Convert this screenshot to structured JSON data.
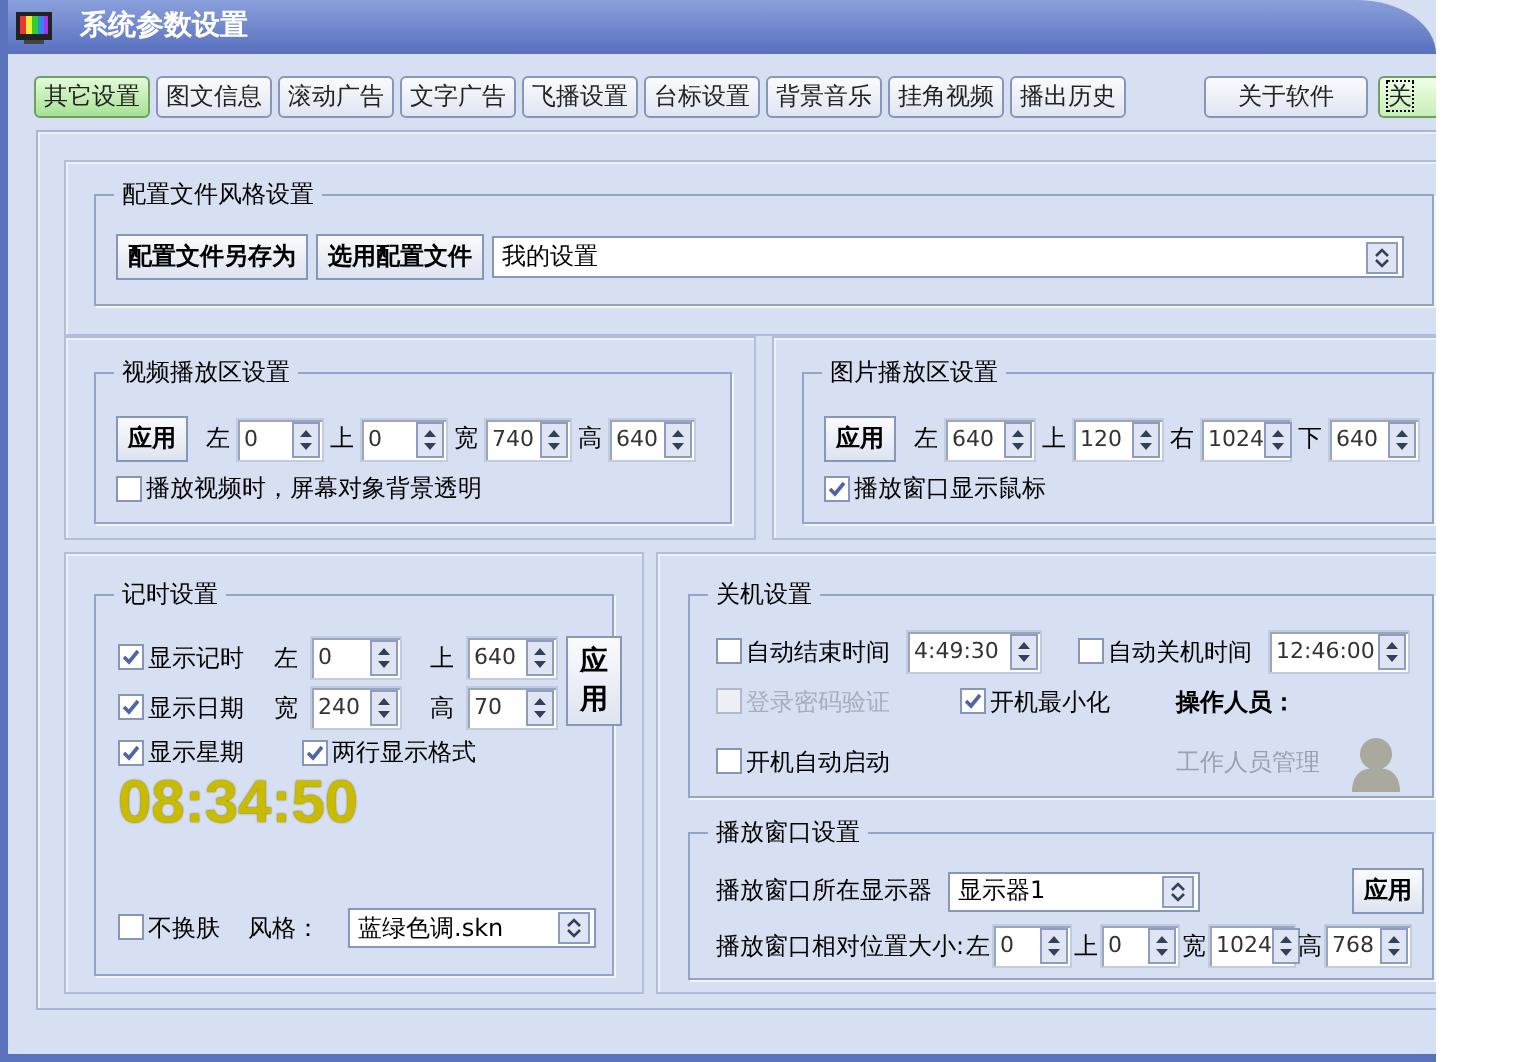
{
  "window": {
    "title": "系统参数设置"
  },
  "tabs": [
    {
      "label": "其它设置",
      "selected": true
    },
    {
      "label": "图文信息",
      "selected": false
    },
    {
      "label": "滚动广告",
      "selected": false
    },
    {
      "label": "文字广告",
      "selected": false
    },
    {
      "label": "飞播设置",
      "selected": false
    },
    {
      "label": "台标设置",
      "selected": false
    },
    {
      "label": "背景音乐",
      "selected": false
    },
    {
      "label": "挂角视频",
      "selected": false
    },
    {
      "label": "播出历史",
      "selected": false
    }
  ],
  "right_buttons": [
    {
      "label": "关于软件",
      "focused": false
    },
    {
      "label": "关",
      "focused": true
    }
  ],
  "config_file": {
    "title": "配置文件风格设置",
    "buttons": [
      "配置文件另存为",
      "选用配置文件"
    ],
    "select_value": "我的设置"
  },
  "video_area": {
    "title": "视频播放区设置",
    "apply": "应用",
    "fields": [
      {
        "label": "左",
        "value": "0"
      },
      {
        "label": "上",
        "value": "0"
      },
      {
        "label": "宽",
        "value": "740"
      },
      {
        "label": "高",
        "value": "640"
      }
    ],
    "checkbox": {
      "label": "播放视频时，屏幕对象背景透明",
      "checked": false
    }
  },
  "picture_area": {
    "title": "图片播放区设置",
    "apply": "应用",
    "fields": [
      {
        "label": "左",
        "value": "640"
      },
      {
        "label": "上",
        "value": "120"
      },
      {
        "label": "右",
        "value": "1024"
      },
      {
        "label": "下",
        "value": "640"
      }
    ],
    "checkbox": {
      "label": "播放窗口显示鼠标",
      "checked": true
    }
  },
  "timer": {
    "title": "记时设置",
    "rows": [
      {
        "checkbox": {
          "label": "显示记时",
          "checked": true
        },
        "fields": [
          {
            "label": "左",
            "value": "0"
          },
          {
            "label": "上",
            "value": "640"
          }
        ]
      },
      {
        "checkbox": {
          "label": "显示日期",
          "checked": true
        },
        "fields": [
          {
            "label": "宽",
            "value": "240"
          },
          {
            "label": "高",
            "value": "70"
          }
        ]
      }
    ],
    "apply": "应用",
    "extra_checks": [
      {
        "label": "显示星期",
        "checked": true
      },
      {
        "label": "两行显示格式",
        "checked": true
      }
    ],
    "clock": "08:34:50",
    "skin_checkbox": {
      "label": "不换肤",
      "checked": false
    },
    "style_label": "风格：",
    "style_value": "蓝绿色调.skn"
  },
  "shutdown": {
    "title": "关机设置",
    "auto_end": {
      "label": "自动结束时间",
      "checked": false,
      "value": "4:49:30"
    },
    "auto_off": {
      "label": "自动关机时间",
      "checked": false,
      "value": "12:46:00"
    },
    "password": {
      "label": "登录密码验证",
      "checked": false,
      "disabled": true
    },
    "minimize": {
      "label": "开机最小化",
      "checked": true
    },
    "operator_label": "操作人员：",
    "autostart": {
      "label": "开机自动启动",
      "checked": false
    },
    "staff_link": "工作人员管理"
  },
  "play_window": {
    "title": "播放窗口设置",
    "monitor_label": "播放窗口所在显示器",
    "monitor_value": "显示器1",
    "apply": "应用",
    "position_label": "播放窗口相对位置大小:",
    "fields": [
      {
        "label": "左",
        "value": "0"
      },
      {
        "label": "上",
        "value": "0"
      },
      {
        "label": "宽",
        "value": "1024"
      },
      {
        "label": "高",
        "value": "768"
      }
    ]
  }
}
